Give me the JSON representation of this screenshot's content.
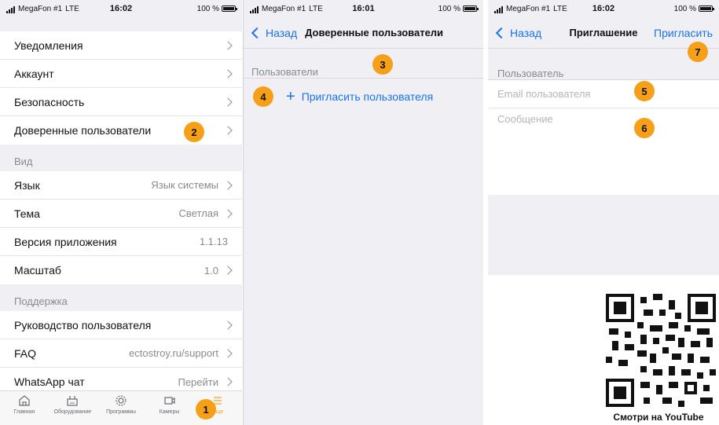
{
  "status_bars": [
    {
      "carrier": "MegaFon #1",
      "network": "LTE",
      "time": "16:02",
      "battery": "100 %"
    },
    {
      "carrier": "MegaFon #1",
      "network": "LTE",
      "time": "16:01",
      "battery": "100 %"
    },
    {
      "carrier": "MegaFon #1",
      "network": "LTE",
      "time": "16:02",
      "battery": "100 %"
    }
  ],
  "settings": {
    "group1": [
      {
        "label": "Уведомления",
        "value": ""
      },
      {
        "label": "Аккаунт",
        "value": ""
      },
      {
        "label": "Безопасность",
        "value": ""
      },
      {
        "label": "Доверенные пользователи",
        "value": ""
      }
    ],
    "view_header": "Вид",
    "group2": [
      {
        "label": "Язык",
        "value": "Язык системы"
      },
      {
        "label": "Тема",
        "value": "Светлая"
      },
      {
        "label": "Версия приложения",
        "value": "1.1.13"
      },
      {
        "label": "Масштаб",
        "value": "1.0"
      }
    ],
    "support_header": "Поддержка",
    "group3": [
      {
        "label": "Руководство пользователя",
        "value": ""
      },
      {
        "label": "FAQ",
        "value": "ectostroy.ru/support"
      },
      {
        "label": "WhatsApp чат",
        "value": "Перейти"
      }
    ]
  },
  "tabbar": [
    {
      "label": "Главная",
      "icon": "home-icon"
    },
    {
      "label": "Оборудование",
      "icon": "device-icon"
    },
    {
      "label": "Программы",
      "icon": "gear-icon"
    },
    {
      "label": "Камеры",
      "icon": "camera-icon"
    },
    {
      "label": "Еще",
      "icon": "menu-icon",
      "active": true
    }
  ],
  "trusted": {
    "back_label": "Назад",
    "title": "Доверенные пользователи",
    "section_label": "Пользователи",
    "invite_label": "Пригласить пользователя"
  },
  "invite": {
    "back_label": "Назад",
    "title": "Приглашение",
    "action_label": "Пригласить",
    "section_label": "Пользователь",
    "email_placeholder": "Email пользователя",
    "message_placeholder": "Сообщение"
  },
  "badges": [
    "1",
    "2",
    "3",
    "4",
    "5",
    "6",
    "7"
  ],
  "youtube_caption": "Смотри на YouTube",
  "colors": {
    "accent": "#1a73e8",
    "badge": "#f6a01a",
    "active_tab": "#f5a623",
    "background": "#efeff4"
  }
}
